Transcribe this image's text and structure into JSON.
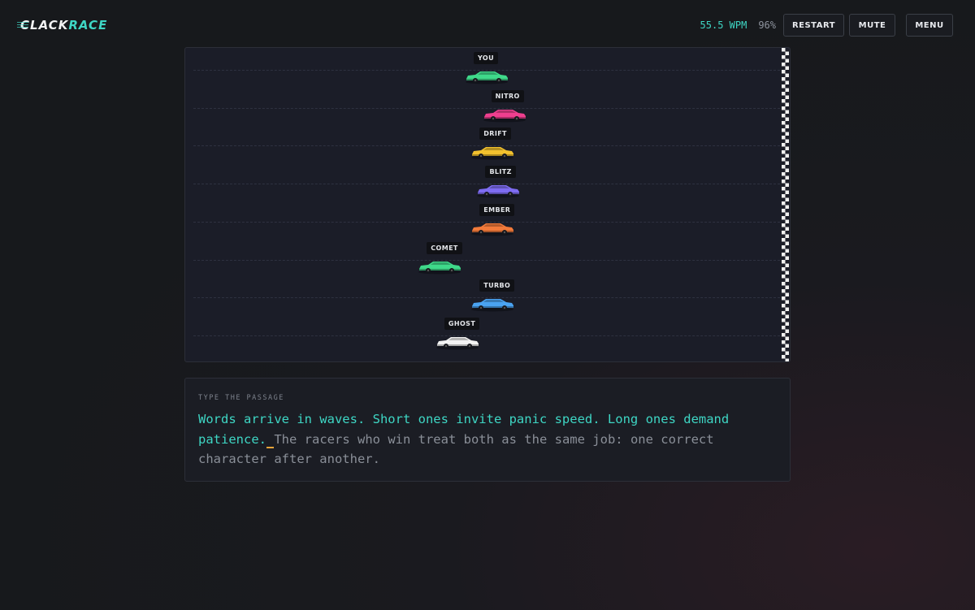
{
  "header": {
    "logo_clack": "CLACK",
    "logo_race": "RACE",
    "wpm": "55.5 WPM",
    "accuracy": "96%",
    "restart_label": "RESTART",
    "mute_label": "MUTE",
    "menu_label": "MENU"
  },
  "race": {
    "racers": [
      {
        "name": "YOU",
        "color": "#3fd98a",
        "progress": 0.5
      },
      {
        "name": "NITRO",
        "color": "#ef3f8f",
        "progress": 0.53
      },
      {
        "name": "DRIFT",
        "color": "#f2c12e",
        "progress": 0.51
      },
      {
        "name": "BLITZ",
        "color": "#7e6cf2",
        "progress": 0.52
      },
      {
        "name": "EMBER",
        "color": "#f27a3a",
        "progress": 0.51
      },
      {
        "name": "COMET",
        "color": "#3fd98a",
        "progress": 0.42
      },
      {
        "name": "TURBO",
        "color": "#4aa3f2",
        "progress": 0.51
      },
      {
        "name": "GHOST",
        "color": "#f2f2f2",
        "progress": 0.45
      }
    ]
  },
  "passage": {
    "label": "TYPE THE PASSAGE",
    "typed": "Words arrive in waves. Short ones invite panic speed. Long ones demand patience.",
    "cursor": " ",
    "untyped": "The racers who win treat both as the same job: one correct character after another."
  },
  "colors": {
    "accent": "#3ed6c4",
    "cursor": "#e8a53a"
  }
}
